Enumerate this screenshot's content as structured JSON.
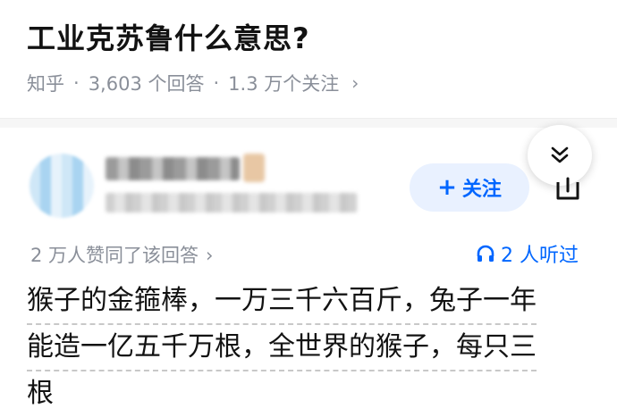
{
  "question": {
    "title": "工业克苏鲁什么意思?",
    "source": "知乎",
    "answers": "3,603 个回答",
    "followers": "1.3 万个关注"
  },
  "answer": {
    "follow_label": "关注",
    "agree_text": "2 万人赞同了该回答",
    "listen_text": "2 人听过",
    "content_lines": [
      "猴子的金箍棒，一万三千六百斤，兔子一年",
      "能造一亿五千万根，全世界的猴子，每只三",
      "根"
    ]
  },
  "colors": {
    "accent": "#0066ff",
    "follow_bg": "#e9f1ff",
    "muted": "#8a8f99"
  },
  "icons": [
    "chevron-right-icon",
    "double-chevron-down-icon",
    "share-icon",
    "headphones-icon",
    "plus-icon"
  ]
}
